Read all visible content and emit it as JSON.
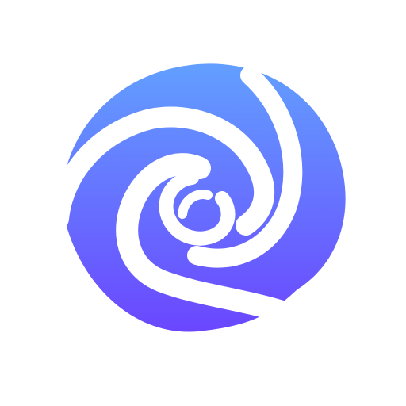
{
  "logo": {
    "icon": "swirl-logo-icon",
    "gradient": {
      "top": "#60B4FF",
      "bottom": "#6D2EFF"
    },
    "background": "#FFFFFF"
  }
}
